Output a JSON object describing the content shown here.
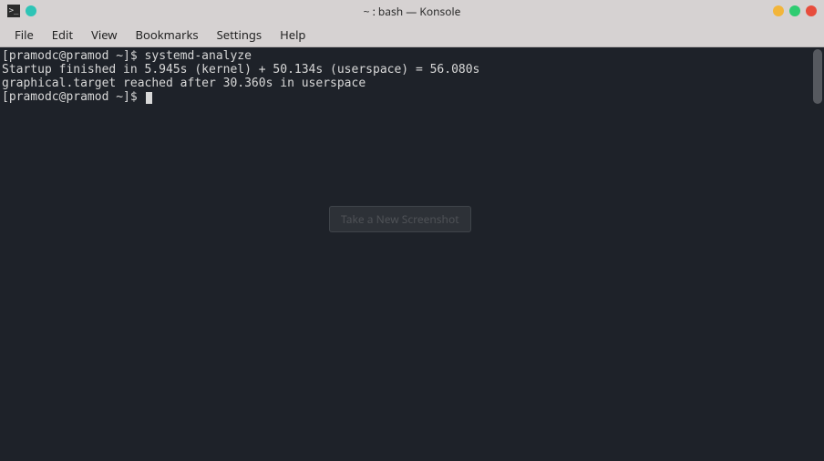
{
  "window": {
    "title": "~ : bash — Konsole",
    "app_icon_glyph": ">_"
  },
  "menubar": {
    "items": [
      "File",
      "Edit",
      "View",
      "Bookmarks",
      "Settings",
      "Help"
    ]
  },
  "terminal": {
    "lines": [
      {
        "prompt": "[pramodc@pramod ~]$ ",
        "text": "systemd-analyze"
      },
      {
        "prompt": "",
        "text": "Startup finished in 5.945s (kernel) + 50.134s (userspace) = 56.080s"
      },
      {
        "prompt": "",
        "text": "graphical.target reached after 30.360s in userspace"
      },
      {
        "prompt": "[pramodc@pramod ~]$ ",
        "text": ""
      }
    ]
  },
  "ghost_button_label": "Take a New Screenshot"
}
